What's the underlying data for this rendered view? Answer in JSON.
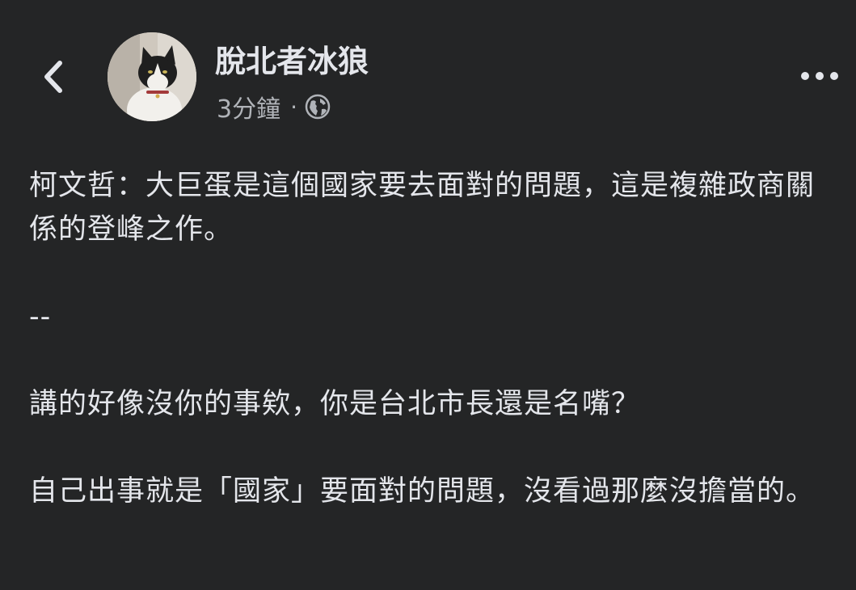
{
  "header": {
    "author_name": "脫北者冰狼",
    "timestamp": "3分鐘",
    "separator": "·",
    "audience_icon": "globe-icon",
    "back_icon": "chevron-left-icon",
    "more_icon": "more-horizontal-icon"
  },
  "post": {
    "paragraphs": [
      "柯文哲：大巨蛋是這個國家要去面對的問題，這是複雜政商關係的登峰之作。",
      "--",
      "講的好像沒你的事欸，你是台北市長還是名嘴？",
      "自己出事就是「國家」要面對的問題，沒看過那麼沒擔當的。"
    ]
  },
  "colors": {
    "background": "#242526",
    "text_primary": "#e4e6eb",
    "text_secondary": "#b0b3b8"
  }
}
